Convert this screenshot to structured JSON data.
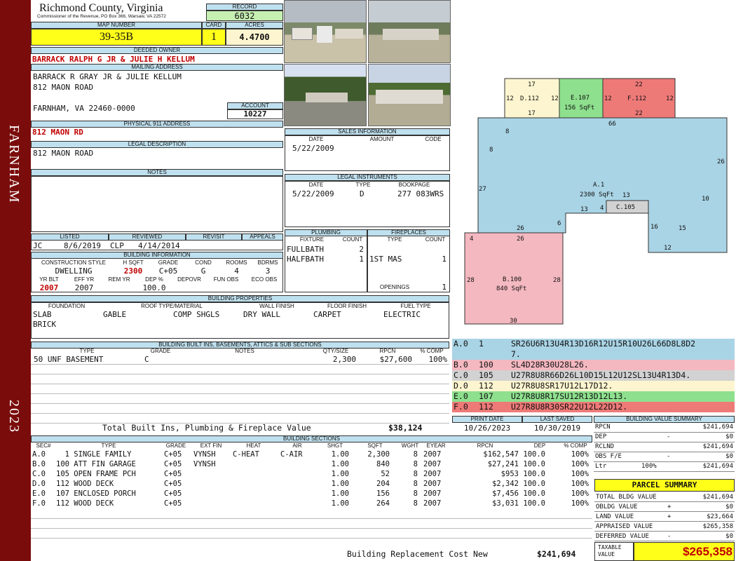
{
  "county": "Richmond County, Virginia",
  "commissioner": "Commissioner of the Revenue, PO Box 366, Warsaw, VA 22572",
  "sidebar": {
    "district": "FARNHAM",
    "year": "2023"
  },
  "record": {
    "label": "RECORD",
    "value": "6032"
  },
  "map": {
    "label": "MAP NUMBER",
    "value": "39-35B"
  },
  "card": {
    "label": "CARD",
    "value": "1"
  },
  "acres": {
    "label": "ACRES",
    "value": "4.4700"
  },
  "owner": {
    "label": "DEEDED OWNER",
    "value": "BARRACK RALPH G JR & JULIE H KELLUM"
  },
  "mailing": {
    "label": "MAILING ADDRESS",
    "line1": "BARRACK R GRAY JR & JULIE KELLUM",
    "line2": "812 MAON ROAD",
    "line3": "FARNHAM, VA 22460-0000"
  },
  "account": {
    "label": "ACCOUNT",
    "value": "10227"
  },
  "physical": {
    "label": "PHYSICAL 911 ADDRESS",
    "value": "812 MAON RD"
  },
  "legal": {
    "label": "LEGAL DESCRIPTION",
    "value": "812 MAON ROAD"
  },
  "notes": {
    "label": "NOTES",
    "value": ""
  },
  "sales": {
    "label": "SALES INFORMATION",
    "cols": [
      "DATE",
      "AMOUNT",
      "CODE"
    ],
    "rows": [
      [
        "5/22/2009",
        "",
        ""
      ]
    ]
  },
  "legal_instr": {
    "label": "LEGAL INSTRUMENTS",
    "cols": [
      "DATE",
      "TYPE",
      "BOOKPAGE"
    ],
    "rows": [
      [
        "5/22/2009",
        "D",
        "277 083WRS"
      ]
    ]
  },
  "review": {
    "cols": [
      "LISTED",
      "REVIEWED",
      "REVISIT",
      "APPEALS"
    ],
    "listed_by": "JC",
    "listed_date": "8/6/2019",
    "reviewed_by": "CLP",
    "reviewed_date": "4/14/2014",
    "revisit": "",
    "appeals": ""
  },
  "plumbing": {
    "label": "PLUMBING",
    "cols": [
      "FIXTURE",
      "COUNT"
    ],
    "rows": [
      [
        "FULLBATH",
        "2"
      ],
      [
        "HALFBATH",
        "1"
      ]
    ]
  },
  "fireplaces": {
    "label": "FIREPLACES",
    "cols": [
      "TYPE",
      "COUNT"
    ],
    "rows": [
      [
        "1ST MAS",
        "1"
      ]
    ],
    "openings_label": "OPENINGS",
    "openings": "1"
  },
  "bldg_info": {
    "label": "BUILDING INFORMATION",
    "cols": [
      "CONSTRUCTION STYLE",
      "H SQFT",
      "GRADE",
      "COND",
      "ROOMS",
      "BDRMS"
    ],
    "style": "DWELLING",
    "hsqft": "2300",
    "grade": "C+05",
    "cond": "G",
    "rooms": "4",
    "bdrms": "3",
    "cols2": [
      "YR BLT",
      "EFF YR",
      "REM YR",
      "DEP %",
      "DEPOVR",
      "FUN OBS",
      "ECO OBS"
    ],
    "yrblt": "2007",
    "effyr": "2007",
    "remyr": "",
    "dep": "100.0",
    "depovr": "",
    "funobs": "",
    "ecoobs": ""
  },
  "props": {
    "label": "BUILDING PROPERTIES",
    "cols": [
      "FOUNDATION",
      "ROOF TYPE/MATERIAL",
      "WALL FINISH",
      "FLOOR FINISH",
      "FUEL TYPE"
    ],
    "foundation1": "SLAB",
    "foundation2": "BRICK",
    "roof_type": "GABLE",
    "roof_mat": "COMP SHGLS",
    "wall": "DRY WALL",
    "floor": "CARPET",
    "fuel": "ELECTRIC"
  },
  "builtins": {
    "label": "BUILDING BUILT INS, BASEMENTS, ATTICS & SUB SECTIONS",
    "cols": [
      "TYPE",
      "GRADE",
      "NOTES",
      "QTY/SIZE",
      "RPCN",
      "% COMP"
    ],
    "rows": [
      {
        "type": "50 UNF BASEMENT",
        "grade": "C",
        "notes": "",
        "qty": "2,300",
        "rpcn": "$27,600",
        "comp": "100%"
      }
    ],
    "total_label": "Total Built Ins, Plumbing & Fireplace Value",
    "total": "$38,124"
  },
  "dates": {
    "print_label": "PRINT DATE",
    "print": "10/26/2023",
    "saved_label": "LAST SAVED",
    "saved": "10/30/2019"
  },
  "sections": {
    "label": "BUILDING SECTIONS",
    "cols": [
      "SEC#",
      "TYPE",
      "GRADE",
      "EXT FIN",
      "HEAT",
      "AIR",
      "SHGT",
      "SQFT",
      "WGHT",
      "EYEAR",
      "RPCN",
      "DEP",
      "% COMP"
    ],
    "rows": [
      {
        "sec": "A.0",
        "type": "  1 SINGLE FAMILY",
        "grade": "C+05",
        "ext": "VYNSH",
        "heat": "C-HEAT",
        "air": "C-AIR",
        "shgt": "1.00",
        "sqft": "2,300",
        "wght": "8",
        "eyear": "2007",
        "rpcn": "$162,547",
        "dep": "100.0",
        "comp": "100%"
      },
      {
        "sec": "B.0",
        "type": "100 ATT FIN GARAGE",
        "grade": "C+05",
        "ext": "VYNSH",
        "heat": "",
        "air": "",
        "shgt": "1.00",
        "sqft": "840",
        "wght": "8",
        "eyear": "2007",
        "rpcn": "$27,241",
        "dep": "100.0",
        "comp": "100%"
      },
      {
        "sec": "C.0",
        "type": "105 OPEN FRAME PCH",
        "grade": "C+05",
        "ext": "",
        "heat": "",
        "air": "",
        "shgt": "1.00",
        "sqft": "52",
        "wght": "8",
        "eyear": "2007",
        "rpcn": "$953",
        "dep": "100.0",
        "comp": "100%"
      },
      {
        "sec": "D.0",
        "type": "112 WOOD DECK",
        "grade": "C+05",
        "ext": "",
        "heat": "",
        "air": "",
        "shgt": "1.00",
        "sqft": "204",
        "wght": "8",
        "eyear": "2007",
        "rpcn": "$2,342",
        "dep": "100.0",
        "comp": "100%"
      },
      {
        "sec": "E.0",
        "type": "107 ENCLOSED PORCH",
        "grade": "C+05",
        "ext": "",
        "heat": "",
        "air": "",
        "shgt": "1.00",
        "sqft": "156",
        "wght": "8",
        "eyear": "2007",
        "rpcn": "$7,456",
        "dep": "100.0",
        "comp": "100%"
      },
      {
        "sec": "F.0",
        "type": "112 WOOD DECK",
        "grade": "C+05",
        "ext": "",
        "heat": "",
        "air": "",
        "shgt": "1.00",
        "sqft": "264",
        "wght": "8",
        "eyear": "2007",
        "rpcn": "$3,031",
        "dep": "100.0",
        "comp": "100%"
      }
    ],
    "total_label": "Building Replacement Cost New",
    "total": "$241,694"
  },
  "bvs": {
    "label": "BUILDING VALUE SUMMARY",
    "rpcn_label": "RPCN",
    "rpcn": "$241,694",
    "dep_label": "DEP",
    "dep_sign": "-",
    "dep": "$0",
    "rclnd_label": "RCLND",
    "rclnd": "$241,694",
    "obs_label": "OBS F/E",
    "obs_sign": "-",
    "obs": "$0",
    "ltr_label": "Ltr",
    "ltr_pct": "100%",
    "ltr": "$241,694"
  },
  "parcel": {
    "title": "PARCEL SUMMARY",
    "total_bldg_label": "TOTAL BLDG VALUE",
    "total_bldg": "$241,694",
    "obldg_label": "OBLDG VALUE",
    "obldg_sign": "+",
    "obldg": "$0",
    "land_label": "LAND VALUE",
    "land_sign": "+",
    "land": "$23,664",
    "appraised_label": "APPRAISED VALUE",
    "appraised": "$265,358",
    "deferred_label": "DEFERRED VALUE",
    "deferred_sign": "-",
    "deferred": "$0",
    "taxable_label1": "TAXABLE",
    "taxable_label2": "VALUE",
    "taxable": "$265,358"
  },
  "sketch": {
    "A": {
      "name": "A.1",
      "area": "2300 SqFt",
      "dims": [
        "8",
        "8",
        "66",
        "26",
        "10",
        "15",
        "16",
        "12",
        "27",
        "26",
        "6",
        "13",
        "4",
        "13"
      ]
    },
    "B": {
      "name": "B.100",
      "area": "840 SqFt",
      "dims": [
        "4",
        "26",
        "28",
        "28",
        "30"
      ]
    },
    "C": {
      "name": "C.105"
    },
    "D": {
      "name": "D.112",
      "dims": [
        "17",
        "17",
        "12",
        "12"
      ]
    },
    "E": {
      "name": "E.107",
      "area": "156 SqFt",
      "dims": [
        "12"
      ]
    },
    "F": {
      "name": "F.112",
      "dims": [
        "22",
        "22",
        "12"
      ]
    }
  },
  "legend": [
    {
      "sec": "A.0",
      "code": "1",
      "vec": "SR26U6R13U4R13D16R12U15R10U26L66D8L8D2",
      "vec2": "7.",
      "color": "#a9d4e5"
    },
    {
      "sec": "B.0",
      "code": "100",
      "vec": "SL4D28R30U28L26.",
      "color": "#f4b8c0"
    },
    {
      "sec": "C.0",
      "code": "105",
      "vec": "U27R8U8R66D26L10D15L12U12SL13U4R13D4.",
      "color": "#d2d2d2"
    },
    {
      "sec": "D.0",
      "code": "112",
      "vec": "U27R8U8SR17U12L17D12.",
      "color": "#fdf5cf"
    },
    {
      "sec": "E.0",
      "code": "107",
      "vec": "U27R8U8R17SU12R13D12L13.",
      "color": "#8ee08e"
    },
    {
      "sec": "F.0",
      "code": "112",
      "vec": "U27R8U8R30SR22U12L22D12.",
      "color": "#ee7a78"
    }
  ]
}
